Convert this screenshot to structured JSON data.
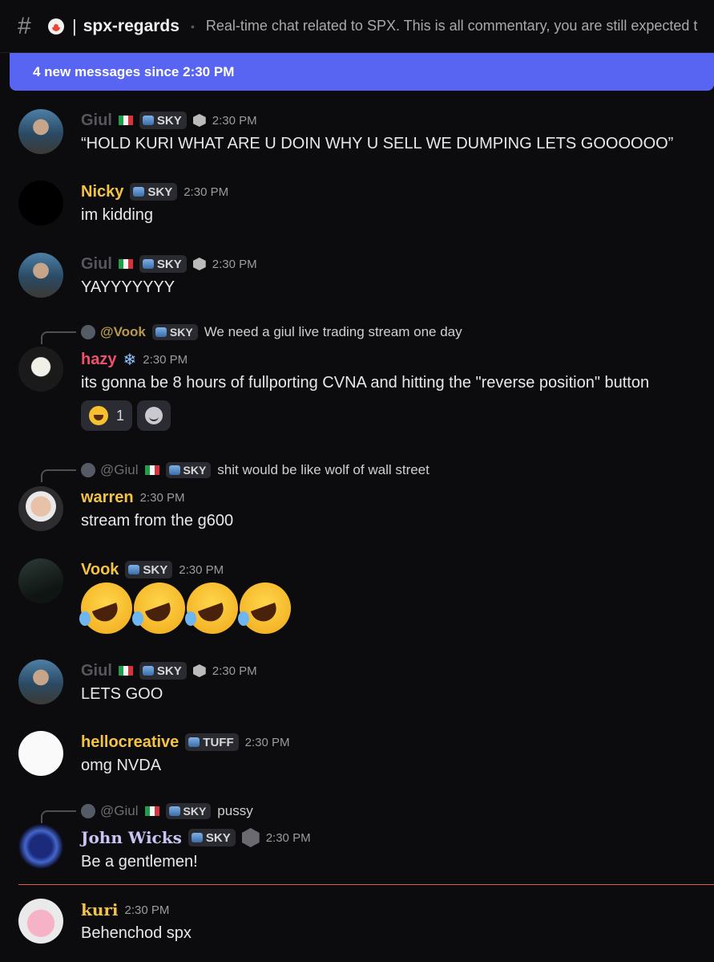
{
  "header": {
    "channel_name": "spx-regards",
    "topic": "Real-time chat related to SPX. This is all commentary, you are still expected t"
  },
  "new_messages_bar": "4 new messages since 2:30 PM",
  "messages": [
    {
      "author": "Giul",
      "tag": "SKY",
      "time": "2:30 PM",
      "text": "“HOLD KURI WHAT ARE U DOIN WHY U SELL WE DUMPING LETS GOOOOOO”"
    },
    {
      "author": "Nicky",
      "tag": "SKY",
      "time": "2:30 PM",
      "text": "im kidding"
    },
    {
      "author": "Giul",
      "tag": "SKY",
      "time": "2:30 PM",
      "text": "YAYYYYYYY"
    },
    {
      "author": "hazy",
      "time": "2:30 PM",
      "text": "its gonna be 8 hours of fullporting CVNA and hitting the \"reverse position\" button",
      "reply": {
        "author": "@Vook",
        "tag": "SKY",
        "text": "We need a giul live trading stream one day"
      },
      "reaction_count": "1"
    },
    {
      "author": "warren",
      "time": "2:30 PM",
      "text": "stream from the g600",
      "reply": {
        "author": "@Giul",
        "tag": "SKY",
        "text": "shit would be like wolf of wall street"
      }
    },
    {
      "author": "Vook",
      "tag": "SKY",
      "time": "2:30 PM"
    },
    {
      "author": "Giul",
      "tag": "SKY",
      "time": "2:30 PM",
      "text": "LETS GOO"
    },
    {
      "author": "hellocreative",
      "tag": "TUFF",
      "time": "2:30 PM",
      "text": "omg NVDA"
    },
    {
      "author": "John Wicks",
      "tag": "SKY",
      "time": "2:30 PM",
      "text": "Be a gentlemen!",
      "reply": {
        "author": "@Giul",
        "tag": "SKY",
        "text": "pussy"
      }
    },
    {
      "author": "kuri",
      "time": "2:30 PM",
      "text": "Behenchod spx"
    }
  ],
  "colors": {
    "accent": "#5865f2",
    "gold_name": "#f5c344",
    "pink_name": "#f0506e",
    "lavender_name": "#c8c4f5",
    "grey_name": "#56565c",
    "new_divider": "#e35a5a"
  },
  "icons": [
    "hashtag-icon",
    "clown-emoji",
    "italy-flag",
    "boost-badge",
    "rofl-emoji",
    "add-reaction-icon",
    "snowflake-icon"
  ]
}
